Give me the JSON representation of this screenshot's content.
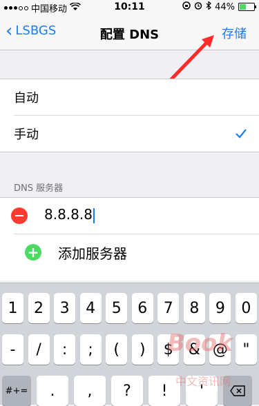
{
  "status": {
    "carrier": "中国移动",
    "time": "10:11",
    "battery": "44%",
    "battery_level": 0.44,
    "battery_color": "#4cd964"
  },
  "nav": {
    "back_label": "LSBGS",
    "title": "配置 DNS",
    "save_label": "存储",
    "accent": "#1a7cf5"
  },
  "mode_options": [
    {
      "label": "自动",
      "selected": false
    },
    {
      "label": "手动",
      "selected": true
    }
  ],
  "dns_section": {
    "header": "DNS 服务器",
    "server_value": "8.8.8.8",
    "add_label": "添加服务器"
  },
  "keyboard": {
    "row1": [
      "1",
      "2",
      "3",
      "4",
      "5",
      "6",
      "7",
      "8",
      "9",
      "0"
    ],
    "row2": [
      "-",
      "/",
      ":",
      ";",
      "(",
      ")",
      "$",
      "&",
      "@",
      "\""
    ],
    "row3_first": "#+=",
    "row3_keys": [
      ".",
      ",",
      "?",
      "!",
      "'"
    ]
  },
  "watermark": {
    "logo": "Book",
    "text": "中文资讯网"
  }
}
